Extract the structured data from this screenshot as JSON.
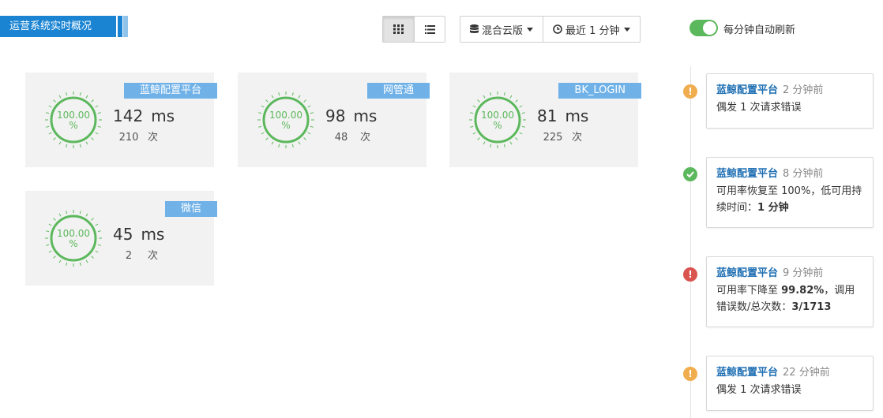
{
  "header": {
    "title": "运营系统实时概况",
    "view_modes": [
      {
        "name": "grid-view",
        "icon": "grid-icon",
        "active": true
      },
      {
        "name": "list-view",
        "icon": "list-icon",
        "active": false
      }
    ],
    "cloud_filter": {
      "icon": "database-icon",
      "label": "混合云版"
    },
    "time_filter": {
      "icon": "clock-icon",
      "label": "最近 1 分钟"
    },
    "auto_refresh": {
      "label": "每分钟自动刷新",
      "enabled": true,
      "color": "#5cb85c"
    }
  },
  "colors": {
    "accent": "#1a84d3",
    "tag": "#70b2e8",
    "ok": "#5cb85c",
    "warn": "#f0ad4e",
    "error": "#d9534f",
    "link": "#1f6fb3"
  },
  "cards": [
    {
      "tag": "蓝鲸配置平台",
      "availability": "100.00",
      "availability_unit": "%",
      "latency": "142",
      "latency_unit": "ms",
      "count": "210",
      "count_unit": "次"
    },
    {
      "tag": "网管通",
      "availability": "100.00",
      "availability_unit": "%",
      "latency": "98",
      "latency_unit": "ms",
      "count": "48",
      "count_unit": "次"
    },
    {
      "tag": "BK_LOGIN",
      "availability": "100.00",
      "availability_unit": "%",
      "latency": "81",
      "latency_unit": "ms",
      "count": "225",
      "count_unit": "次"
    },
    {
      "tag": "微信",
      "availability": "100.00",
      "availability_unit": "%",
      "latency": "45",
      "latency_unit": "ms",
      "count": "2",
      "count_unit": "次"
    }
  ],
  "events": [
    {
      "status": "warning",
      "icon": "exclamation-icon",
      "source": "蓝鲸配置平台",
      "time": "2 分钟前",
      "body": [
        {
          "text": "偶发 1 次请求错误",
          "bold": false
        }
      ]
    },
    {
      "status": "success",
      "icon": "check-icon",
      "source": "蓝鲸配置平台",
      "time": "8 分钟前",
      "body": [
        {
          "text": "可用率恢复至 100%，低可用持续时间：",
          "bold": false
        },
        {
          "text": "1 分钟",
          "bold": true
        }
      ]
    },
    {
      "status": "error",
      "icon": "exclamation-icon",
      "source": "蓝鲸配置平台",
      "time": "9 分钟前",
      "body": [
        {
          "text": "可用率下降至 ",
          "bold": false
        },
        {
          "text": "99.82%",
          "bold": true
        },
        {
          "text": "，调用错误数/总次数：",
          "bold": false
        },
        {
          "text": "3/1713",
          "bold": true
        }
      ]
    },
    {
      "status": "warning",
      "icon": "exclamation-icon",
      "source": "蓝鲸配置平台",
      "time": "22 分钟前",
      "body": [
        {
          "text": "偶发 1 次请求错误",
          "bold": false
        }
      ]
    }
  ]
}
